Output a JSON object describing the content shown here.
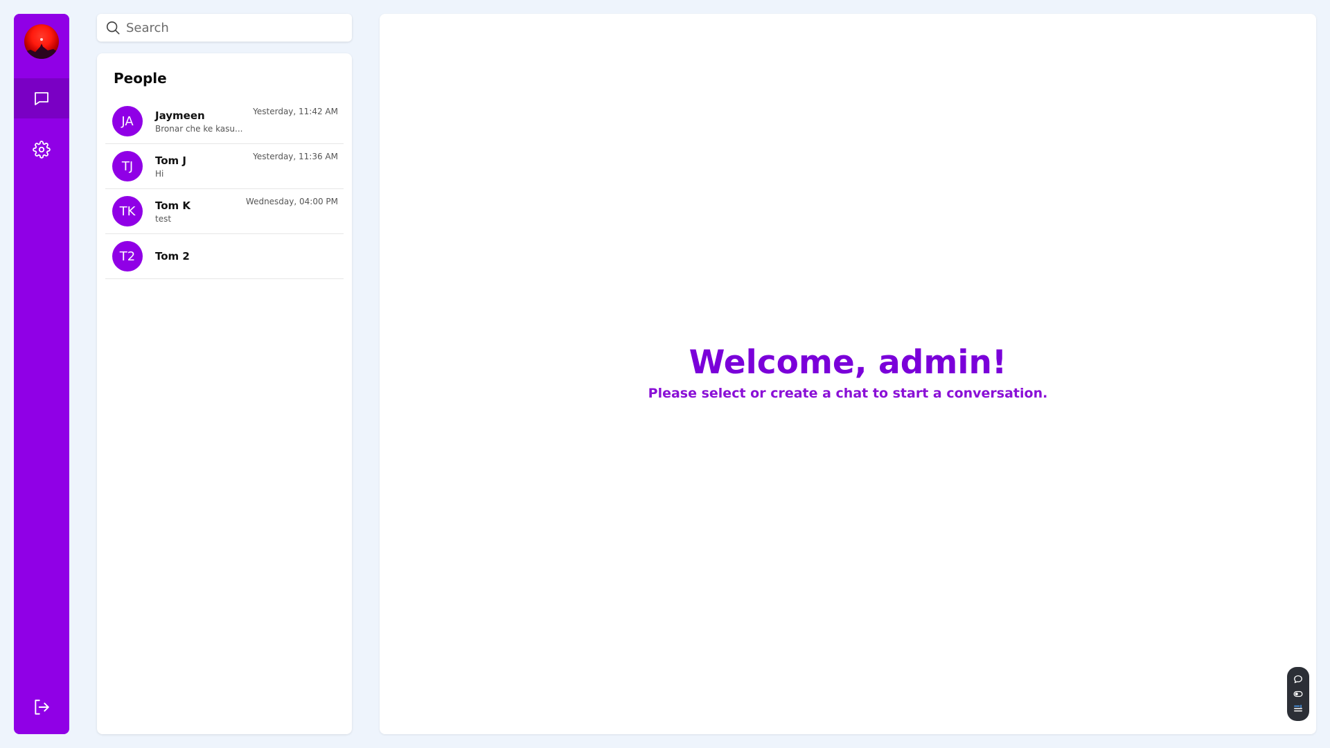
{
  "search": {
    "placeholder": "Search"
  },
  "people": {
    "title": "People",
    "items": [
      {
        "initials": "JA",
        "name": "Jaymeen",
        "message": "Bronar che ke kasu...",
        "time": "Yesterday, 11:42 AM"
      },
      {
        "initials": "TJ",
        "name": "Tom J",
        "message": "Hi",
        "time": "Yesterday, 11:36 AM"
      },
      {
        "initials": "TK",
        "name": "Tom K",
        "message": "test",
        "time": "Wednesday, 04:00 PM"
      },
      {
        "initials": "T2",
        "name": "Tom 2",
        "message": "",
        "time": ""
      }
    ]
  },
  "main": {
    "welcome": "Welcome, admin!",
    "subtitle": "Please select or create a chat to start a conversation."
  },
  "sidebar": {
    "icons": [
      "avatar",
      "chat-icon",
      "gear-icon",
      "logout-icon"
    ],
    "active": "chat"
  },
  "widget": {
    "icons": [
      "chat-bubble-icon",
      "toggle-icon",
      "list-icon"
    ]
  },
  "colors": {
    "accent": "#9000e6",
    "accent_dark": "#7a00c4",
    "heading": "#7a00d9",
    "background": "#eef4fc"
  }
}
